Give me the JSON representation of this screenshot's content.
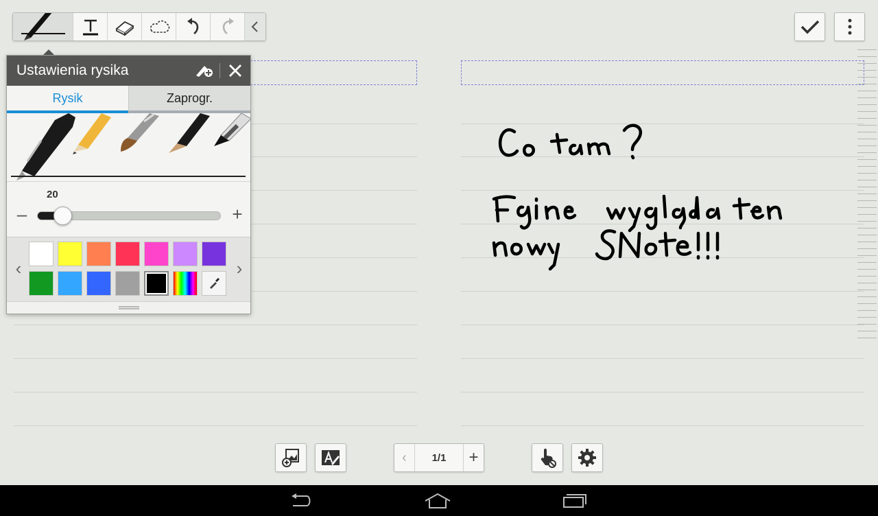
{
  "toolbar": {
    "tools": [
      "pen",
      "text",
      "eraser",
      "lasso",
      "undo",
      "redo",
      "collapse"
    ]
  },
  "pen_settings": {
    "title": "Ustawienia rysika",
    "tabs": [
      {
        "label": "Rysik",
        "active": true
      },
      {
        "label": "Zaprogr.",
        "active": false
      }
    ],
    "pens": [
      "fountain-pen",
      "pencil",
      "brush",
      "calligraphy-pen",
      "marker"
    ],
    "size": {
      "value": "20",
      "level": 0.1
    },
    "colors": {
      "row1": [
        "#ffffff",
        "#ffff33",
        "#ff7f50",
        "#ff3355",
        "#ff44cc",
        "#cc88ff",
        "#7733dd"
      ],
      "row2": [
        "#119922",
        "#33a6ff",
        "#3366ff",
        "#a0a0a0",
        "#000000"
      ],
      "selected": "#000000"
    }
  },
  "note": {
    "line1": "Co tam?",
    "line2": "Fajnie wygląda ten",
    "line3": "nowy SNote!!!"
  },
  "pager": {
    "label": "1/1"
  },
  "colors": {
    "accent": "#1b8ed6",
    "background": "#e6e8e3",
    "panel_header": "#545553"
  }
}
